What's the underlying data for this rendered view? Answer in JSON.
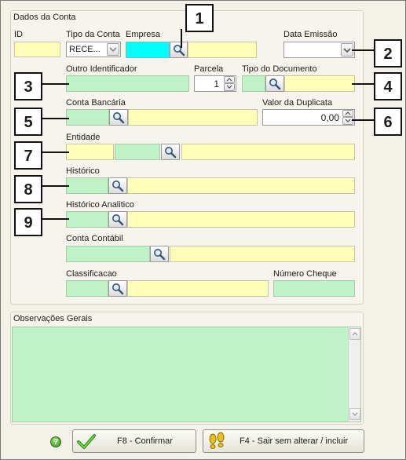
{
  "section_title": "Dados da Conta",
  "labels": {
    "id": "ID",
    "tipo_conta": "Tipo da Conta",
    "empresa": "Empresa",
    "data_emissao": "Data Emissão",
    "outro_identificador": "Outro Identificador",
    "parcela": "Parcela",
    "tipo_documento": "Tipo do Documento",
    "conta_bancaria": "Conta Bancária",
    "valor_duplicata": "Valor da Duplicata",
    "entidade": "Entidade",
    "historico": "Histórico",
    "historico_analitico": "Histórico Analitico",
    "conta_contabil": "Conta Contábil",
    "classificacao": "Classificacao",
    "numero_cheque": "Número Cheque"
  },
  "values": {
    "tipo_conta": "RECE...",
    "parcela": "1",
    "valor_duplicata": "0,00"
  },
  "observacoes_title": "Observações Gerais",
  "buttons": {
    "confirmar": "F8 - Confirmar",
    "sair": "F4 - Sair sem alterar / incluir"
  },
  "callouts": [
    "1",
    "2",
    "3",
    "4",
    "5",
    "6",
    "7",
    "8",
    "9"
  ],
  "colors": {
    "yellow_field": "#ffffb9",
    "green_field": "#bff2c6",
    "cyan_field": "#00ffff",
    "window_bg": "#f4f2e8"
  },
  "icons": [
    "magnifier-icon",
    "checkmark-icon",
    "footprints-icon",
    "help-icon",
    "chevron-down-icon",
    "spin-up-icon",
    "spin-down-icon"
  ]
}
